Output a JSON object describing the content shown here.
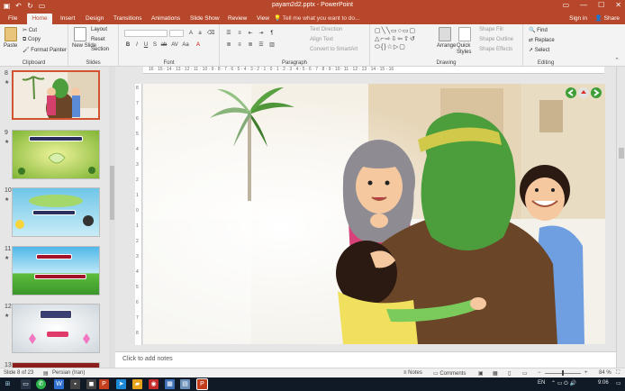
{
  "titlebar": {
    "title": "payam2d2.pptx - PowerPoint",
    "qat": [
      "save-icon",
      "undo-icon",
      "redo-icon",
      "present-icon"
    ],
    "min": "—",
    "max": "☐",
    "close": "✕",
    "restore": "▭"
  },
  "tabs": [
    {
      "label": "File",
      "active": false
    },
    {
      "label": "Home",
      "active": true
    },
    {
      "label": "Insert",
      "active": false
    },
    {
      "label": "Design",
      "active": false
    },
    {
      "label": "Transitions",
      "active": false
    },
    {
      "label": "Animations",
      "active": false
    },
    {
      "label": "Slide Show",
      "active": false
    },
    {
      "label": "Review",
      "active": false
    },
    {
      "label": "View",
      "active": false
    }
  ],
  "tell_me": "Tell me what you want to do...",
  "sign_in": "Sign in",
  "share": "Share",
  "ribbon": {
    "clipboard": {
      "label": "Clipboard",
      "paste": "Paste",
      "cut": "Cut",
      "copy": "Copy",
      "format_painter": "Format Painter"
    },
    "slides": {
      "label": "Slides",
      "new_slide": "New Slide",
      "layout": "Layout",
      "reset": "Reset",
      "section": "Section"
    },
    "font": {
      "label": "Font"
    },
    "paragraph": {
      "label": "Paragraph",
      "text_direction": "Text Direction",
      "align_text": "Align Text",
      "convert_smartart": "Convert to SmartArt"
    },
    "drawing": {
      "label": "Drawing",
      "arrange": "Arrange",
      "quick_styles": "Quick Styles",
      "shape_fill": "Shape Fill",
      "shape_outline": "Shape Outline",
      "shape_effects": "Shape Effects"
    },
    "editing": {
      "label": "Editing",
      "find": "Find",
      "replace": "Replace",
      "select": "Select"
    }
  },
  "ruler": {
    "h": "16 · 15 · 14 · 13 · 12 · 11 · 10 · 9 · 8 · 7 · 6 · 5 · 4 · 3 · 2 · 1 · 0 · 1 · 2 · 3 · 4 · 5 · 6 · 7 · 8 · 9 · 10 · 11 · 12 · 13 · 14 · 15 · 16",
    "v": [
      "8",
      "7",
      "6",
      "5",
      "4",
      "3",
      "2",
      "1",
      "0",
      "1",
      "2",
      "3",
      "4",
      "5",
      "6",
      "7",
      "8"
    ]
  },
  "thumbnails": [
    {
      "num": "8",
      "star": "★",
      "selected": true
    },
    {
      "num": "9",
      "star": "★",
      "selected": false,
      "caption": "؟ سلام از دیدن عزیزان به چه کاری است"
    },
    {
      "num": "10",
      "star": "★",
      "selected": false,
      "caption": "... دلیل نمی‌شود نسبت به ..."
    },
    {
      "num": "11",
      "star": "★",
      "selected": false,
      "caption": "● بپرسید لطفاً به دوستان ..."
    },
    {
      "num": "12",
      "star": "★",
      "selected": false,
      "caption": "... آیا تا به حال ..."
    },
    {
      "num": "13",
      "star": "",
      "selected": false
    }
  ],
  "notes": {
    "placeholder": "Click to add notes"
  },
  "status": {
    "slide_of": "Slide 8 of 23",
    "language": "Persian (Iran)",
    "notes_btn": "Notes",
    "comments_btn": "Comments",
    "zoom": "84 %"
  },
  "taskbar": {
    "lang": "EN",
    "time": "9:06"
  },
  "colors": {
    "accent": "#b7472a",
    "ribbon_bg": "#f3f3f3",
    "selected_border": "#d35230"
  }
}
